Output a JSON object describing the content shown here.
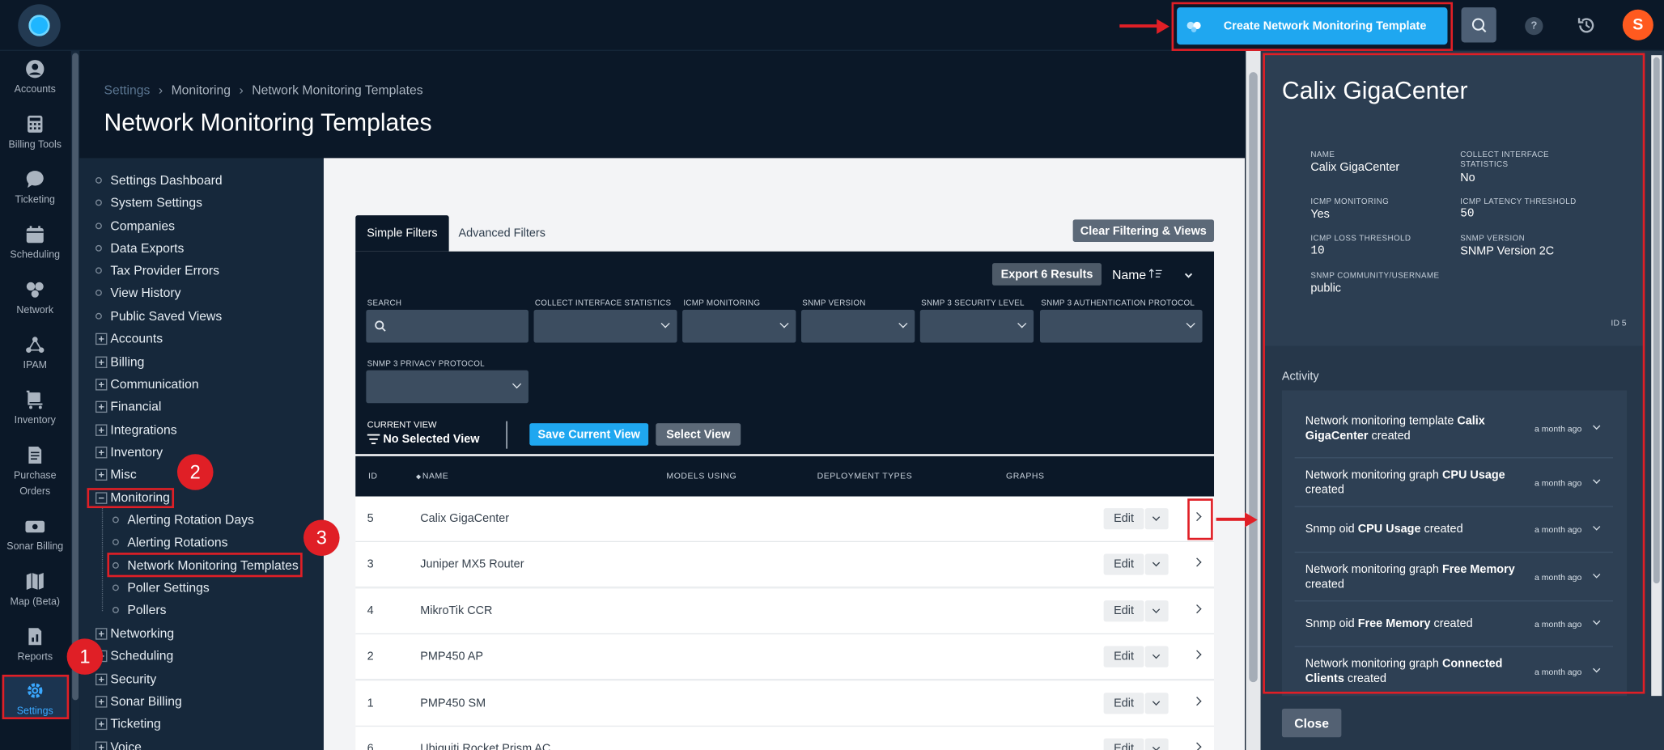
{
  "topbar": {
    "create_label": "Create Network Monitoring Template",
    "help_label": "?",
    "avatar_initial": "S"
  },
  "rail": {
    "items": [
      {
        "label": "Accounts",
        "icon": "user-icon"
      },
      {
        "label": "Billing Tools",
        "icon": "calculator-icon"
      },
      {
        "label": "Ticketing",
        "icon": "chat-bubble-icon"
      },
      {
        "label": "Scheduling",
        "icon": "calendar-icon"
      },
      {
        "label": "Network",
        "icon": "network-icon"
      },
      {
        "label": "IPAM",
        "icon": "nodes-icon"
      },
      {
        "label": "Inventory",
        "icon": "cart-icon"
      },
      {
        "label": "Purchase Orders",
        "icon": "document-icon"
      },
      {
        "label": "Sonar Billing",
        "icon": "card-icon"
      },
      {
        "label": "Map (Beta)",
        "icon": "map-icon"
      },
      {
        "label": "Reports",
        "icon": "report-icon"
      },
      {
        "label": "Settings",
        "icon": "gear-icon"
      }
    ]
  },
  "breadcrumb": [
    "Settings",
    "Monitoring",
    "Network Monitoring Templates"
  ],
  "page_title": "Network Monitoring Templates",
  "tree": {
    "bullets": [
      "Settings Dashboard",
      "System Settings",
      "Companies",
      "Data Exports",
      "Tax Provider Errors",
      "View History",
      "Public Saved Views"
    ],
    "groups_before": [
      "Accounts",
      "Billing",
      "Communication",
      "Financial",
      "Integrations",
      "Inventory",
      "Misc"
    ],
    "monitoring": "Monitoring",
    "monitoring_children": [
      "Alerting Rotation Days",
      "Alerting Rotations",
      "Network Monitoring Templates",
      "Poller Settings",
      "Pollers"
    ],
    "groups_after": [
      "Networking",
      "Scheduling",
      "Security",
      "Sonar Billing",
      "Ticketing",
      "Voice"
    ]
  },
  "filters": {
    "tab_simple": "Simple Filters",
    "tab_advanced": "Advanced Filters",
    "clear": "Clear Filtering & Views",
    "export": "Export 6 Results",
    "sort": "Name",
    "labels": {
      "search": "SEARCH",
      "collect": "COLLECT INTERFACE STATISTICS",
      "icmp": "ICMP MONITORING",
      "snmp_version": "SNMP VERSION",
      "snmp3_security": "SNMP 3 SECURITY LEVEL",
      "snmp3_auth": "SNMP 3 AUTHENTICATION PROTOCOL",
      "snmp3_privacy": "SNMP 3 PRIVACY PROTOCOL"
    },
    "current_view_label": "CURRENT VIEW",
    "current_view": "No Selected View",
    "save_view": "Save Current View",
    "select_view": "Select View"
  },
  "table": {
    "columns": [
      "ID",
      "NAME",
      "MODELS USING",
      "DEPLOYMENT TYPES",
      "GRAPHS"
    ],
    "edit_label": "Edit",
    "rows": [
      {
        "id": "5",
        "name": "Calix GigaCenter"
      },
      {
        "id": "3",
        "name": "Juniper MX5 Router"
      },
      {
        "id": "4",
        "name": "MikroTik CCR"
      },
      {
        "id": "2",
        "name": "PMP450 AP"
      },
      {
        "id": "1",
        "name": "PMP450 SM"
      },
      {
        "id": "6",
        "name": "Ubiquiti Rocket Prism AC"
      }
    ]
  },
  "panel": {
    "title": "Calix GigaCenter",
    "fields": {
      "name_l": "NAME",
      "name_v": "Calix GigaCenter",
      "collect_l": "COLLECT INTERFACE STATISTICS",
      "collect_v": "No",
      "icmp_l": "ICMP MONITORING",
      "icmp_v": "Yes",
      "latency_l": "ICMP LATENCY THRESHOLD",
      "latency_v": "50",
      "loss_l": "ICMP LOSS THRESHOLD",
      "loss_v": "10",
      "snmp_l": "SNMP VERSION",
      "snmp_v": "SNMP Version 2C",
      "community_l": "SNMP COMMUNITY/USERNAME",
      "community_v": "public"
    },
    "id_label": "ID 5",
    "activity_title": "Activity",
    "activity": [
      {
        "pre": "Network monitoring template ",
        "bold": "Calix GigaCenter",
        "post": " created",
        "time": "a month ago"
      },
      {
        "pre": "Network monitoring graph ",
        "bold": "CPU Usage",
        "post": " created",
        "time": "a month ago"
      },
      {
        "pre": "Snmp oid ",
        "bold": "CPU Usage",
        "post": " created",
        "time": "a month ago"
      },
      {
        "pre": "Network monitoring graph ",
        "bold": "Free Memory",
        "post": " created",
        "time": "a month ago"
      },
      {
        "pre": "Snmp oid ",
        "bold": "Free Memory",
        "post": " created",
        "time": "a month ago"
      },
      {
        "pre": "Network monitoring graph ",
        "bold": "Connected Clients",
        "post": " created",
        "time": "a month ago"
      }
    ],
    "close": "Close"
  },
  "annotations": {
    "badges": [
      "1",
      "2",
      "3"
    ],
    "color": "#e01f26"
  },
  "colors": {
    "accent": "#1fa7f0",
    "nav_bg": "#0b1828",
    "tree_bg": "#16283b",
    "panel_bg": "#26374a"
  }
}
